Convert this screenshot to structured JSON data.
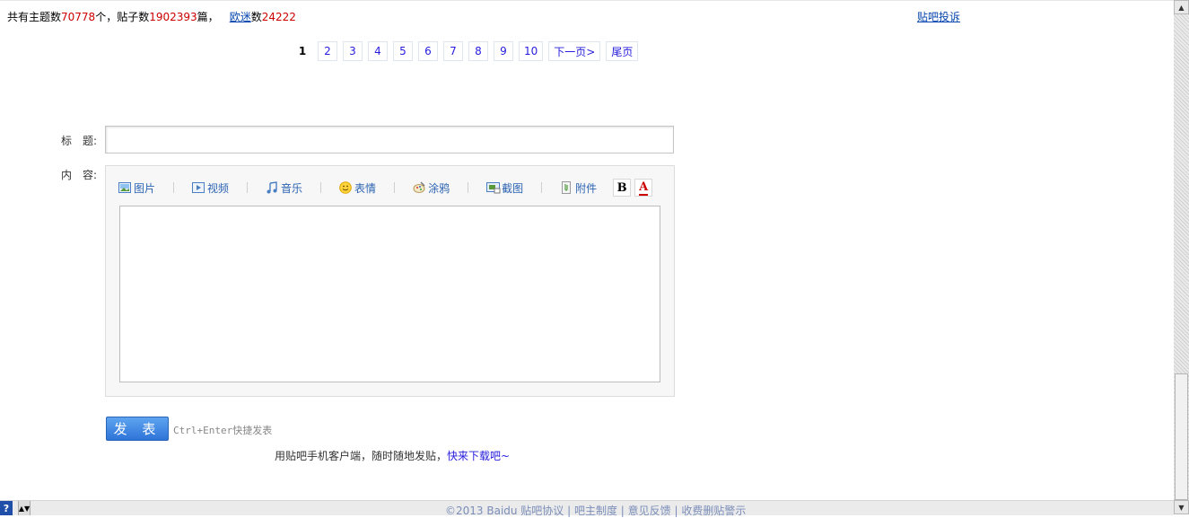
{
  "stats": {
    "prefix": "共有主题数",
    "topics": "70778",
    "topics_unit": "个，贴子数",
    "posts": "1902393",
    "posts_unit": "篇，",
    "fans_label": "欧迷",
    "fans_suffix": "数",
    "fans": "24222"
  },
  "report_link": "贴吧投诉",
  "pager": {
    "current": "1",
    "pages": [
      "2",
      "3",
      "4",
      "5",
      "6",
      "7",
      "8",
      "9",
      "10"
    ],
    "next": "下一页>",
    "last": "尾页"
  },
  "form": {
    "title_label": "标　题:",
    "content_label": "内　容:",
    "toolbar": [
      {
        "label": "图片",
        "icon": "image-icon"
      },
      {
        "label": "视频",
        "icon": "video-icon"
      },
      {
        "label": "音乐",
        "icon": "music-icon"
      },
      {
        "label": "表情",
        "icon": "smiley-icon"
      },
      {
        "label": "涂鸦",
        "icon": "graffiti-icon"
      },
      {
        "label": "截图",
        "icon": "screenshot-icon"
      },
      {
        "label": "附件",
        "icon": "attachment-icon"
      }
    ],
    "bold": "B",
    "color": "A",
    "submit": "发 表",
    "hint": "Ctrl+Enter快捷发表"
  },
  "mobile": {
    "text": "用贴吧手机客户端，随时随地发贴，",
    "link": "快来下载吧~"
  },
  "footer": {
    "help": "?",
    "links": "©2013 Baidu 贴吧协议 | 吧主制度 | 意见反馈 | 收费删贴警示"
  }
}
